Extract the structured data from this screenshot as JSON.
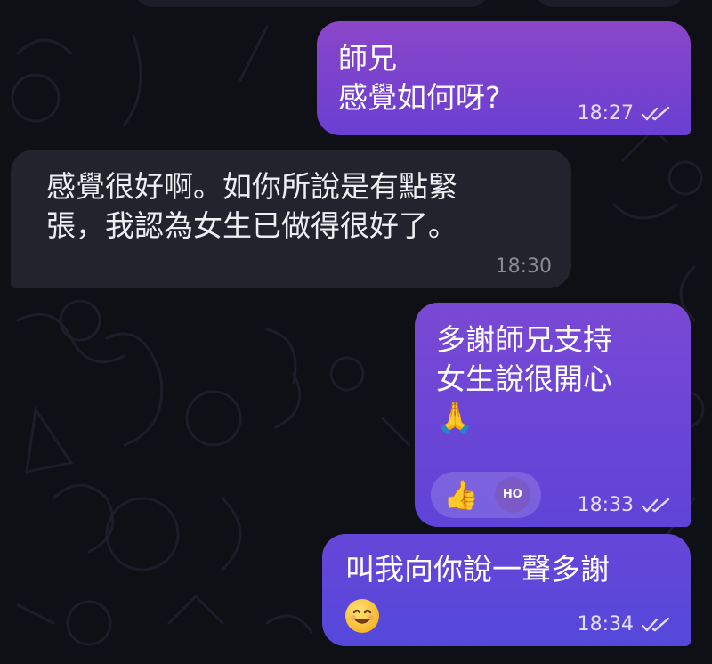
{
  "messages": [
    {
      "direction": "out",
      "text": "師兄\n感覺如何呀?",
      "time": "18:27",
      "status": "read-double-check"
    },
    {
      "direction": "in",
      "text": "感覺很好啊。如你所說是有點緊\n張，我認為女生已做得很好了。",
      "time": "18:30"
    },
    {
      "direction": "out",
      "text": "多謝師兄支持\n女生說很開心",
      "emoji": "🙏",
      "time": "18:33",
      "status": "read-double-check",
      "reaction": {
        "emoji": "👍",
        "avatar_initials": "HO"
      }
    },
    {
      "direction": "out",
      "text": "叫我向你說一聲多謝",
      "emoji": "smiling-face-emoji",
      "time": "18:34",
      "status": "read-double-check"
    }
  ],
  "colors": {
    "background": "#0f0f16",
    "outgoing_bubble_top": "#8a46c8",
    "outgoing_bubble_bottom": "#5448da",
    "incoming_bubble": "#23232e"
  }
}
